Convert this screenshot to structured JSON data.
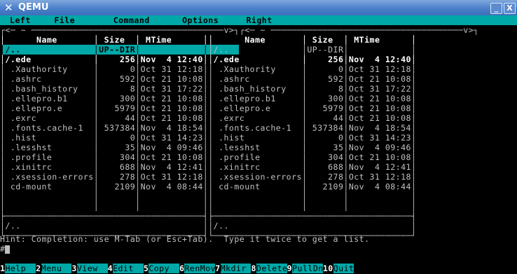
{
  "window": {
    "title": "QEMU",
    "minimize_label": "_",
    "close_label": "X"
  },
  "menubar": {
    "items": [
      "Left",
      "File",
      "Command",
      "Options",
      "Right"
    ]
  },
  "columns": {
    "name": "Name",
    "size": "Size",
    "mtime": "MTime"
  },
  "left_panel": {
    "parent_row": {
      "name": "/..",
      "size": "UP--DIR",
      "mtime": ""
    },
    "files": [
      {
        "name": "/.ede",
        "size": "256",
        "mtime": "Nov  4 12:40"
      },
      {
        "name": " .Xauthority",
        "size": "0",
        "mtime": "Oct 31 12:18"
      },
      {
        "name": " .ashrc",
        "size": "592",
        "mtime": "Oct 21 10:08"
      },
      {
        "name": " .bash_history",
        "size": "8",
        "mtime": "Oct 31 17:22"
      },
      {
        "name": " .ellepro.b1",
        "size": "300",
        "mtime": "Oct 21 10:08"
      },
      {
        "name": " .ellepro.e",
        "size": "5979",
        "mtime": "Oct 21 10:08"
      },
      {
        "name": " .exrc",
        "size": "44",
        "mtime": "Oct 21 10:08"
      },
      {
        "name": " .fonts.cache-1",
        "size": "537384",
        "mtime": "Nov  4 18:54"
      },
      {
        "name": " .hist",
        "size": "0",
        "mtime": "Oct 31 14:23"
      },
      {
        "name": " .lesshst",
        "size": "35",
        "mtime": "Nov  4 09:46"
      },
      {
        "name": " .profile",
        "size": "304",
        "mtime": "Oct 21 10:08"
      },
      {
        "name": " .xinitrc",
        "size": "688",
        "mtime": "Nov  4 12:41"
      },
      {
        "name": " .xsession-errors",
        "size": "278",
        "mtime": "Oct 31 12:18"
      },
      {
        "name": " cd-mount",
        "size": "2109",
        "mtime": "Nov  4 08:44"
      }
    ],
    "status": "/.."
  },
  "right_panel": {
    "parent_row": {
      "name": "/..",
      "size": "UP--DIR",
      "mtime": ""
    },
    "files": [
      {
        "name": "/.ede",
        "size": "256",
        "mtime": "Nov  4 12:40"
      },
      {
        "name": " .Xauthority",
        "size": "0",
        "mtime": "Oct 31 12:18"
      },
      {
        "name": " .ashrc",
        "size": "592",
        "mtime": "Oct 21 10:08"
      },
      {
        "name": " .bash_history",
        "size": "8",
        "mtime": "Oct 31 17:22"
      },
      {
        "name": " .ellepro.b1",
        "size": "300",
        "mtime": "Oct 21 10:08"
      },
      {
        "name": " .ellepro.e",
        "size": "5979",
        "mtime": "Oct 21 10:08"
      },
      {
        "name": " .exrc",
        "size": "44",
        "mtime": "Oct 21 10:08"
      },
      {
        "name": " .fonts.cache-1",
        "size": "537384",
        "mtime": "Nov  4 18:54"
      },
      {
        "name": " .hist",
        "size": "0",
        "mtime": "Oct 31 14:23"
      },
      {
        "name": " .lesshst",
        "size": "35",
        "mtime": "Nov  4 09:46"
      },
      {
        "name": " .profile",
        "size": "304",
        "mtime": "Oct 21 10:08"
      },
      {
        "name": " .xinitrc",
        "size": "688",
        "mtime": "Nov  4 12:41"
      },
      {
        "name": " .xsession-errors",
        "size": "278",
        "mtime": "Oct 31 12:18"
      },
      {
        "name": " cd-mount",
        "size": "2109",
        "mtime": "Nov  4 08:44"
      }
    ],
    "status": "/.."
  },
  "hint": "Hint: Completion: use M-Tab (or Esc+Tab).  Type it twice to get a list.",
  "prompt": "#",
  "function_keys": [
    {
      "num": "1",
      "label": "Help"
    },
    {
      "num": "2",
      "label": "Menu"
    },
    {
      "num": "3",
      "label": "View"
    },
    {
      "num": "4",
      "label": "Edit"
    },
    {
      "num": "5",
      "label": "Copy"
    },
    {
      "num": "6",
      "label": "RenMov"
    },
    {
      "num": "7",
      "label": "Mkdir"
    },
    {
      "num": "8",
      "label": "Delete"
    },
    {
      "num": "9",
      "label": "PullDn"
    },
    {
      "num": "10",
      "label": "Quit"
    }
  ],
  "colors": {
    "titlebar": "#4a7fc9",
    "menubar": "#00a8a8",
    "terminal_bg": "#000000",
    "text": "#c0c0c0"
  }
}
